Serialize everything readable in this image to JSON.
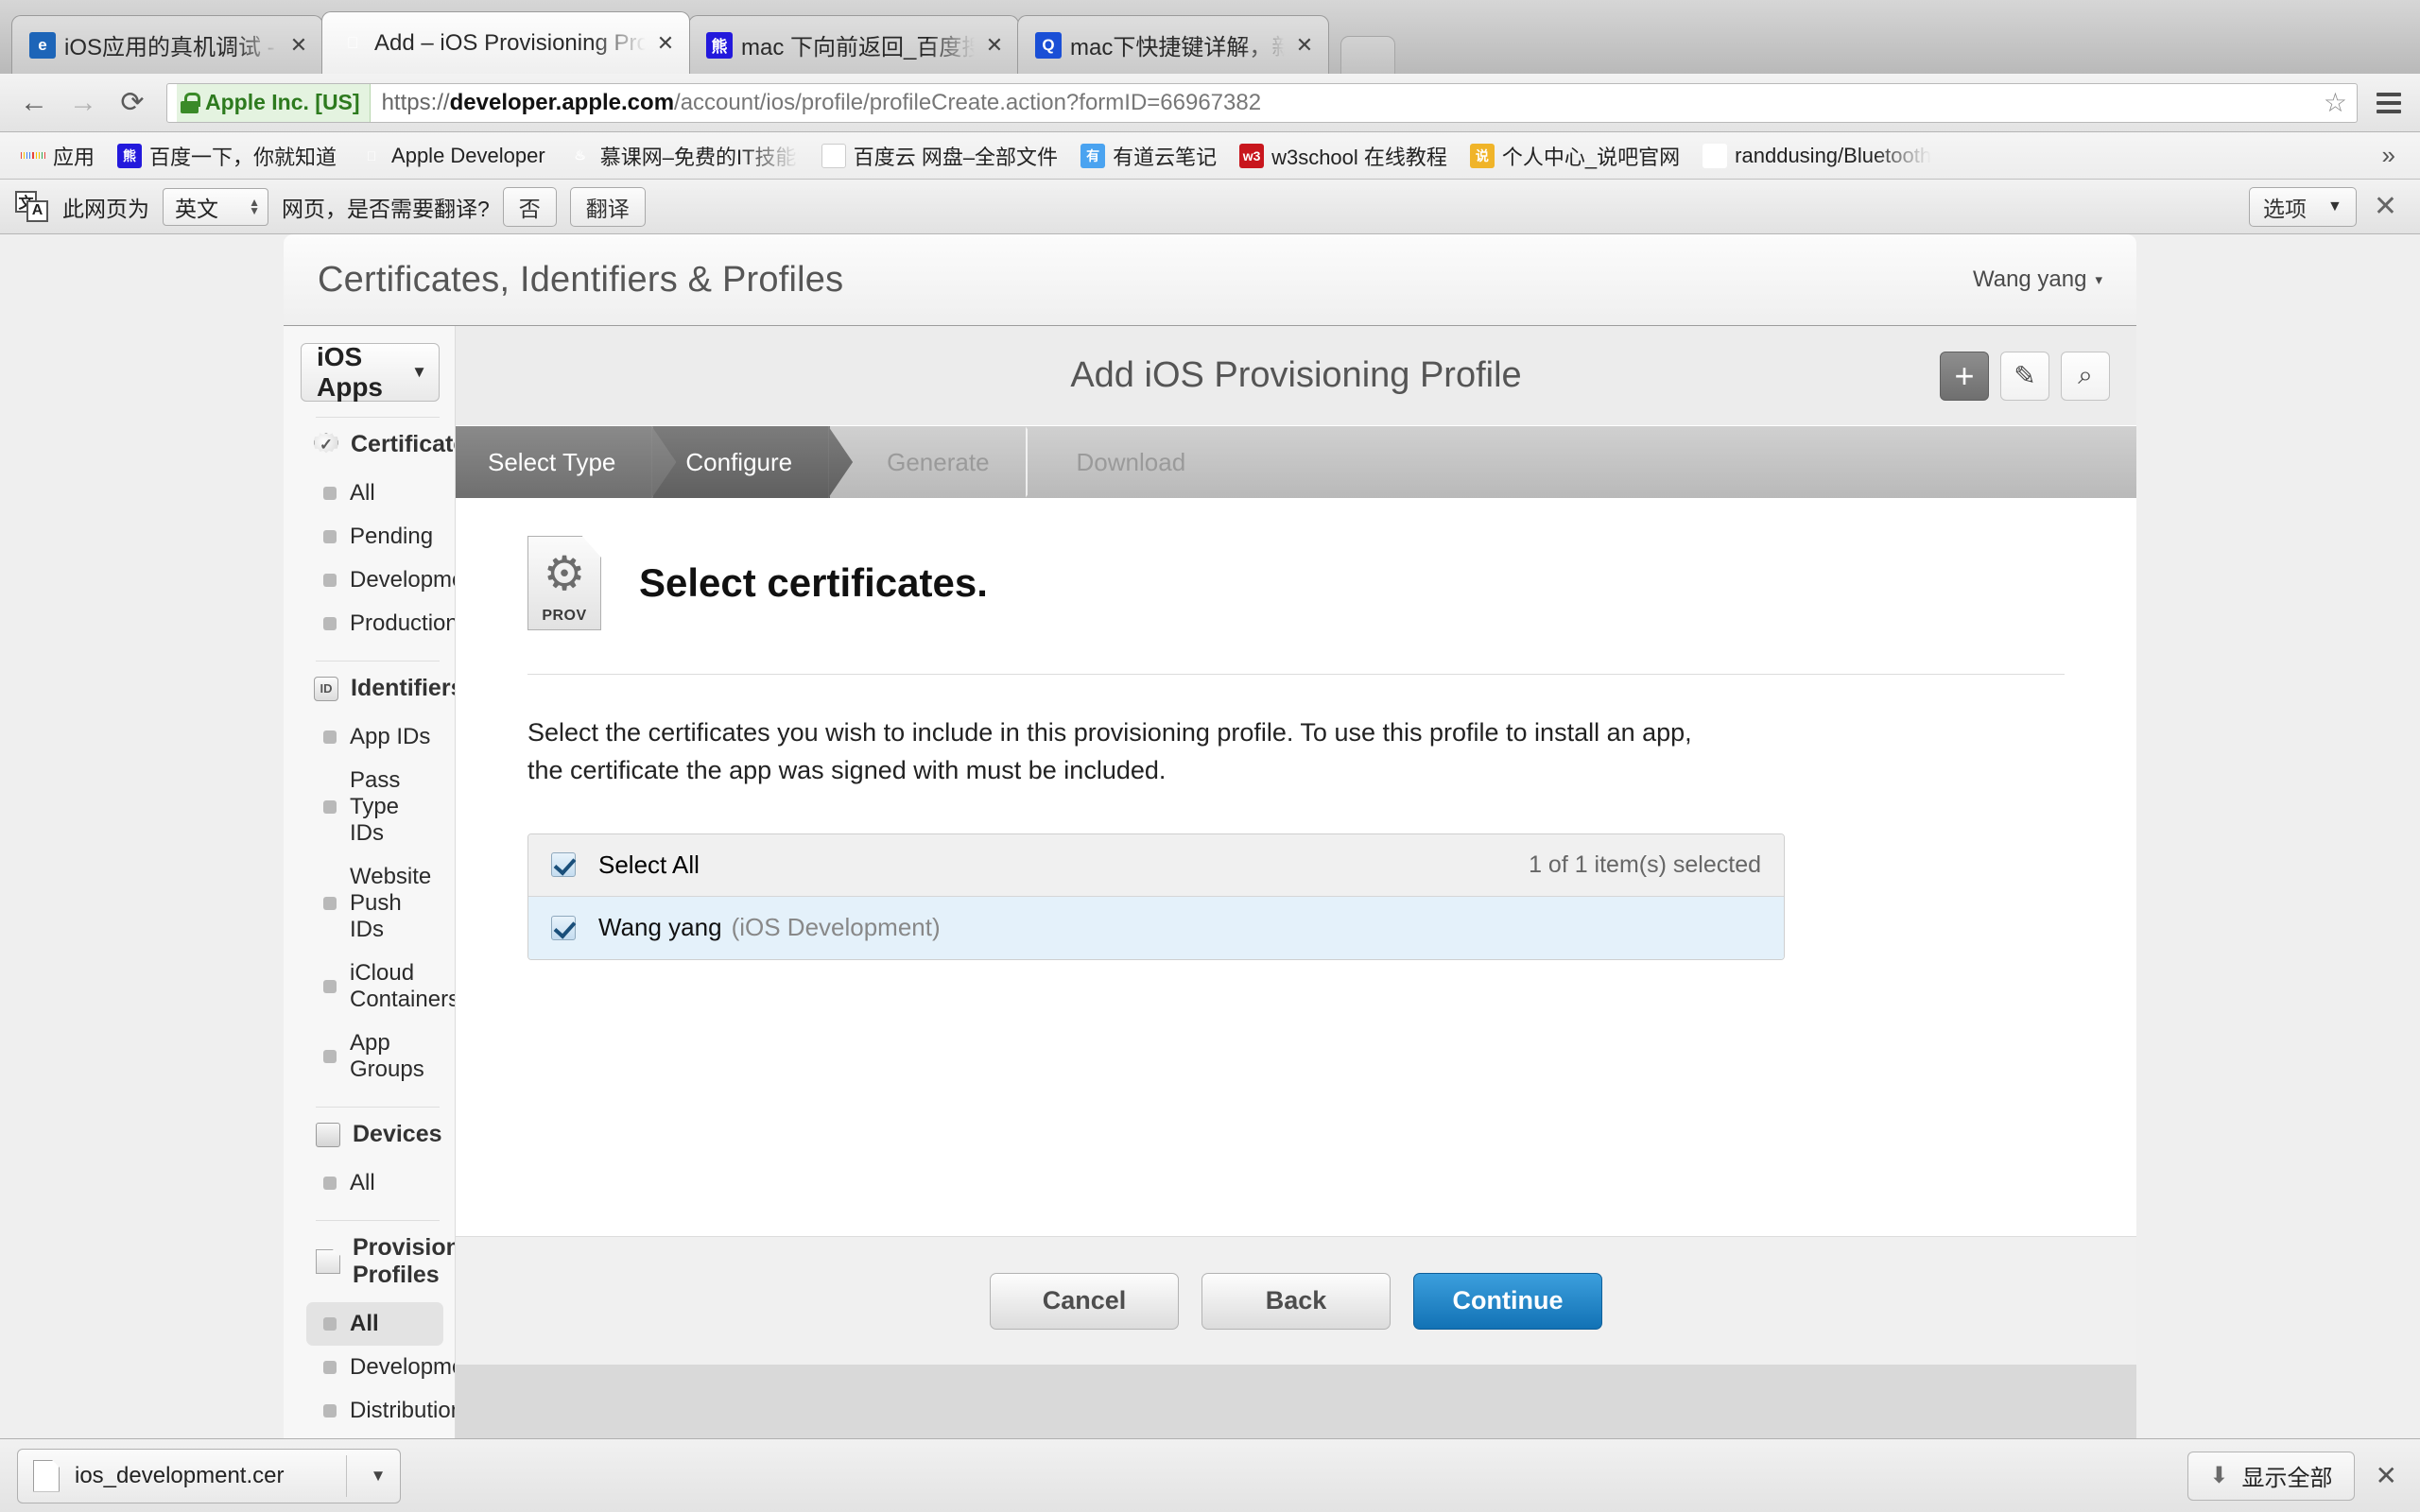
{
  "browser": {
    "tabs": [
      {
        "title": "iOS应用的真机调试 - 每天进",
        "favicon": "globe-icon",
        "active": false
      },
      {
        "title": "Add – iOS Provisioning Pro",
        "favicon": "apple-icon",
        "active": true
      },
      {
        "title": "mac 下向前返回_百度搜索",
        "favicon": "baidu-icon",
        "active": false
      },
      {
        "title": "mac下快捷键详解，新手必读",
        "favicon": "search-engine-icon",
        "active": false
      }
    ],
    "tab_close_label": "✕",
    "nav": {
      "back": "←",
      "forward": "→",
      "reload": "⟳"
    },
    "omnibox": {
      "ev_label": "Apple Inc. [US]",
      "url_scheme": "https://",
      "url_host": "developer.apple.com",
      "url_path": "/account/ios/profile/profileCreate.action?formID=66967382",
      "star": "☆"
    },
    "bookmarks": [
      {
        "label": "应用",
        "icon": "apps-grid-icon"
      },
      {
        "label": "百度一下，你就知道",
        "icon": "baidu-icon"
      },
      {
        "label": "Apple Developer",
        "icon": "apple-icon"
      },
      {
        "label": "慕课网–免费的IT技能学",
        "icon": "flame-icon",
        "truncated": true
      },
      {
        "label": "百度云 网盘–全部文件",
        "icon": "baidu-pan-icon"
      },
      {
        "label": "有道云笔记",
        "icon": "youdao-icon"
      },
      {
        "label": "w3school 在线教程",
        "icon": "w3school-icon"
      },
      {
        "label": "个人中心_说吧官网",
        "icon": "shuoba-icon"
      },
      {
        "label": "randdusing/Bluetooth",
        "icon": "github-icon",
        "truncated": true
      }
    ],
    "bookmarks_overflow": "»",
    "translate_bar": {
      "icon": "translate-icon",
      "icon_char_1": "文",
      "icon_char_2": "A",
      "prefix": "此网页为",
      "language": "英文",
      "suffix": "网页，是否需要翻译?",
      "no_label": "否",
      "translate_label": "翻译",
      "options_label": "选项",
      "options_caret": "▼",
      "close_label": "✕"
    }
  },
  "page": {
    "header": {
      "title": "Certificates, Identifiers & Profiles",
      "account_name": "Wang yang",
      "account_caret": "▾"
    },
    "sidebar": {
      "app_select": {
        "value": "iOS Apps",
        "caret": "▼"
      },
      "groups": [
        {
          "title": "Certificates",
          "icon": "certificate-badge-icon",
          "items": [
            {
              "label": "All",
              "selected": false
            },
            {
              "label": "Pending",
              "selected": false
            },
            {
              "label": "Development",
              "selected": false
            },
            {
              "label": "Production",
              "selected": false
            }
          ]
        },
        {
          "title": "Identifiers",
          "icon": "id-card-icon",
          "items": [
            {
              "label": "App IDs",
              "selected": false
            },
            {
              "label": "Pass Type IDs",
              "selected": false
            },
            {
              "label": "Website Push IDs",
              "selected": false
            },
            {
              "label": "iCloud Containers",
              "selected": false
            },
            {
              "label": "App Groups",
              "selected": false
            }
          ]
        },
        {
          "title": "Devices",
          "icon": "device-icon",
          "items": [
            {
              "label": "All",
              "selected": false
            }
          ]
        },
        {
          "title": "Provisioning Profiles",
          "icon": "document-icon",
          "items": [
            {
              "label": "All",
              "selected": true
            },
            {
              "label": "Development",
              "selected": false
            },
            {
              "label": "Distribution",
              "selected": false
            }
          ]
        }
      ]
    },
    "content": {
      "wizard_title": "Add iOS Provisioning Profile",
      "action_icons": [
        {
          "name": "add-icon",
          "glyph": "+",
          "active": true
        },
        {
          "name": "edit-icon",
          "glyph": "✎",
          "active": false
        },
        {
          "name": "search-icon",
          "glyph": "⌕",
          "active": false
        }
      ],
      "steps": [
        {
          "label": "Select Type",
          "state": "done"
        },
        {
          "label": "Configure",
          "state": "current"
        },
        {
          "label": "Generate",
          "state": "todo"
        },
        {
          "label": "Download",
          "state": "todo"
        }
      ],
      "hero": {
        "icon_name": "provisioning-profile-icon",
        "icon_label": "PROV",
        "icon_glyph": "⚙",
        "title": "Select certificates."
      },
      "lead_text": "Select the certificates you wish to include in this provisioning profile. To use this profile to install an app, the certificate the app was signed with must be included.",
      "cert_list": {
        "select_all_label": "Select All",
        "count_label": "1 of 1 item(s) selected",
        "items": [
          {
            "name": "Wang yang",
            "detail": "(iOS Development)",
            "checked": true
          }
        ]
      },
      "buttons": {
        "cancel": "Cancel",
        "back": "Back",
        "continue": "Continue"
      }
    }
  },
  "downloads": {
    "file_name": "ios_development.cer",
    "file_icon": "file-icon",
    "caret": "▼",
    "show_all_label": "显示全部",
    "show_all_icon": "download-arrow-icon",
    "show_all_glyph": "⬇",
    "close_label": "✕"
  },
  "colors": {
    "accent_blue": "#1272b5",
    "ev_green": "#2d7a1e",
    "selected_row": "#e4f1fa",
    "step_active": "#5f5f5f"
  }
}
